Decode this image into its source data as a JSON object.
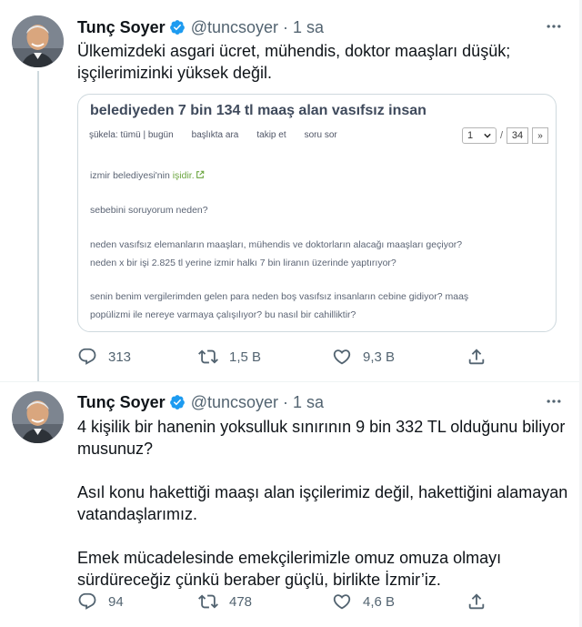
{
  "colors": {
    "accent": "#1d9bf0",
    "text": "#0f1419",
    "muted": "#536471",
    "link_green": "#6ba53f"
  },
  "tweets": [
    {
      "author": {
        "name": "Tunç Soyer",
        "handle": "@tuncsoyer",
        "time": "1 sa",
        "verified_icon": "verified-badge-icon",
        "avatar": "avatar"
      },
      "text": [
        "Ülkemizdeki asgari ücret, mühendis, doktor maaşları düşük;",
        "işçilerimizinki yüksek değil."
      ],
      "quote": {
        "title": "belediyeden 7 bin 134 tl maaş alan vasıfsız insan",
        "nav": [
          "şükela:  tümü | bugün",
          "başlıkta ara",
          "takip et",
          "soru sor"
        ],
        "page_current": "1",
        "page_sep": "/",
        "page_total": "34",
        "next": "»",
        "lines": {
          "l1_prefix": "izmir belediyesi'nin ",
          "l1_link": "işidir.",
          "l2": "sebebini soruyorum neden?",
          "l3": "neden vasıfsız elemanların maaşları, mühendis ve doktorların alacağı maaşları geçiyor?",
          "l4": "neden x bir işi 2.825 tl yerine izmir halkı 7 bin liranın üzerinde yaptırıyor?",
          "l5": "senin benim vergilerimden gelen para neden boş vasıfsız insanların cebine gidiyor? maaş",
          "l6": "popülizmi ile nereye varmaya çalışılıyor? bu nasıl bir cahilliktir?"
        }
      },
      "actions": {
        "replies": "313",
        "retweets": "1,5 B",
        "likes": "9,3 B"
      }
    },
    {
      "author": {
        "name": "Tunç Soyer",
        "handle": "@tuncsoyer",
        "time": "1 sa",
        "verified_icon": "verified-badge-icon",
        "avatar": "avatar"
      },
      "text": [
        "4 kişilik bir hanenin yoksulluk sınırının 9 bin 332 TL olduğunu biliyor musunuz?",
        "Asıl konu hakettiği maaşı alan işçilerimiz değil, hakettiğini alamayan vatandaşlarımız.",
        "Emek mücadelesinde emekçilerimizle omuz omuza olmayı sürdüreceğiz çünkü beraber güçlü, birlikte İzmir’iz."
      ],
      "actions": {
        "replies": "94",
        "retweets": "478",
        "likes": "4,6 B"
      }
    }
  ],
  "icons": [
    "more-options-icon",
    "reply-icon",
    "retweet-icon",
    "like-icon",
    "share-icon",
    "external-link-icon",
    "chevron-down-icon"
  ]
}
